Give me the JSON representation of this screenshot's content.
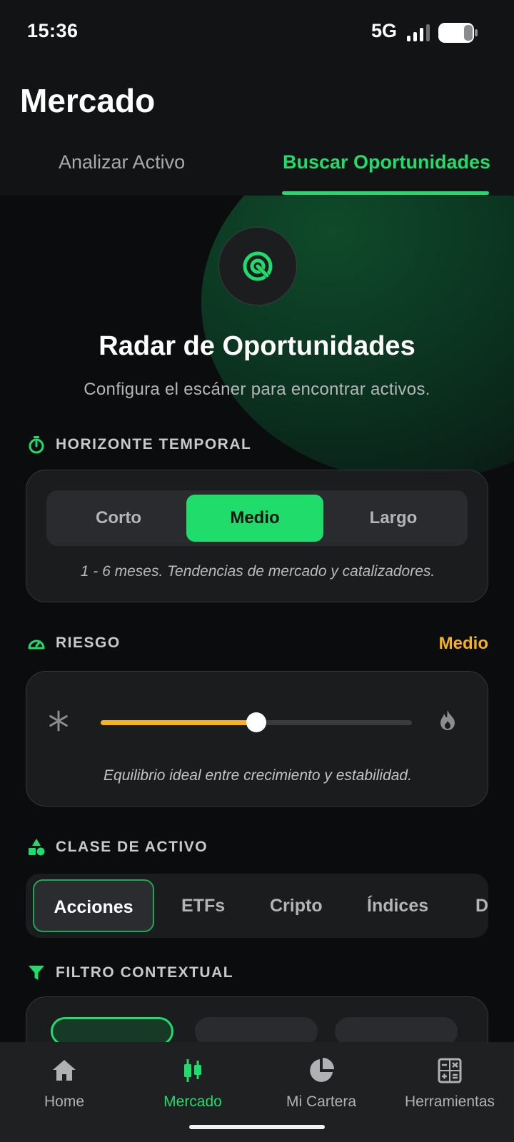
{
  "status_bar": {
    "time": "15:36",
    "network": "5G"
  },
  "header": {
    "title": "Mercado",
    "tabs": [
      {
        "label": "Analizar Activo",
        "active": false
      },
      {
        "label": "Buscar Oportunidades",
        "active": true
      }
    ]
  },
  "radar": {
    "icon": "radar-icon",
    "title": "Radar de Oportunidades",
    "subtitle": "Configura el escáner para encontrar activos."
  },
  "horizon": {
    "label": "HORIZONTE TEMPORAL",
    "icon": "stopwatch-icon",
    "options": [
      "Corto",
      "Medio",
      "Largo"
    ],
    "selected": "Medio",
    "note": "1 - 6 meses. Tendencias de mercado y catalizadores."
  },
  "risk": {
    "label": "RIESGO",
    "icon": "speedometer-icon",
    "value_label": "Medio",
    "level": 0.5,
    "min_icon": "snowflake-icon",
    "max_icon": "flame-icon",
    "note": "Equilibrio ideal entre crecimiento y estabilidad."
  },
  "asset_class": {
    "label": "CLASE DE ACTIVO",
    "icon": "shapes-icon",
    "options": [
      "Acciones",
      "ETFs",
      "Cripto",
      "Índices",
      "D"
    ],
    "selected": "Acciones"
  },
  "filter": {
    "label": "FILTRO CONTEXTUAL",
    "icon": "funnel-icon"
  },
  "bottom_nav": [
    {
      "label": "Home",
      "icon": "home-icon",
      "active": false
    },
    {
      "label": "Mercado",
      "icon": "candlestick-icon",
      "active": true
    },
    {
      "label": "Mi Cartera",
      "icon": "pie-chart-icon",
      "active": false
    },
    {
      "label": "Herramientas",
      "icon": "calculator-icon",
      "active": false
    }
  ],
  "colors": {
    "accent": "#1fdc6b",
    "risk": "#f5b31d",
    "background": "#0b0c0e",
    "card": "#1b1c1e"
  }
}
